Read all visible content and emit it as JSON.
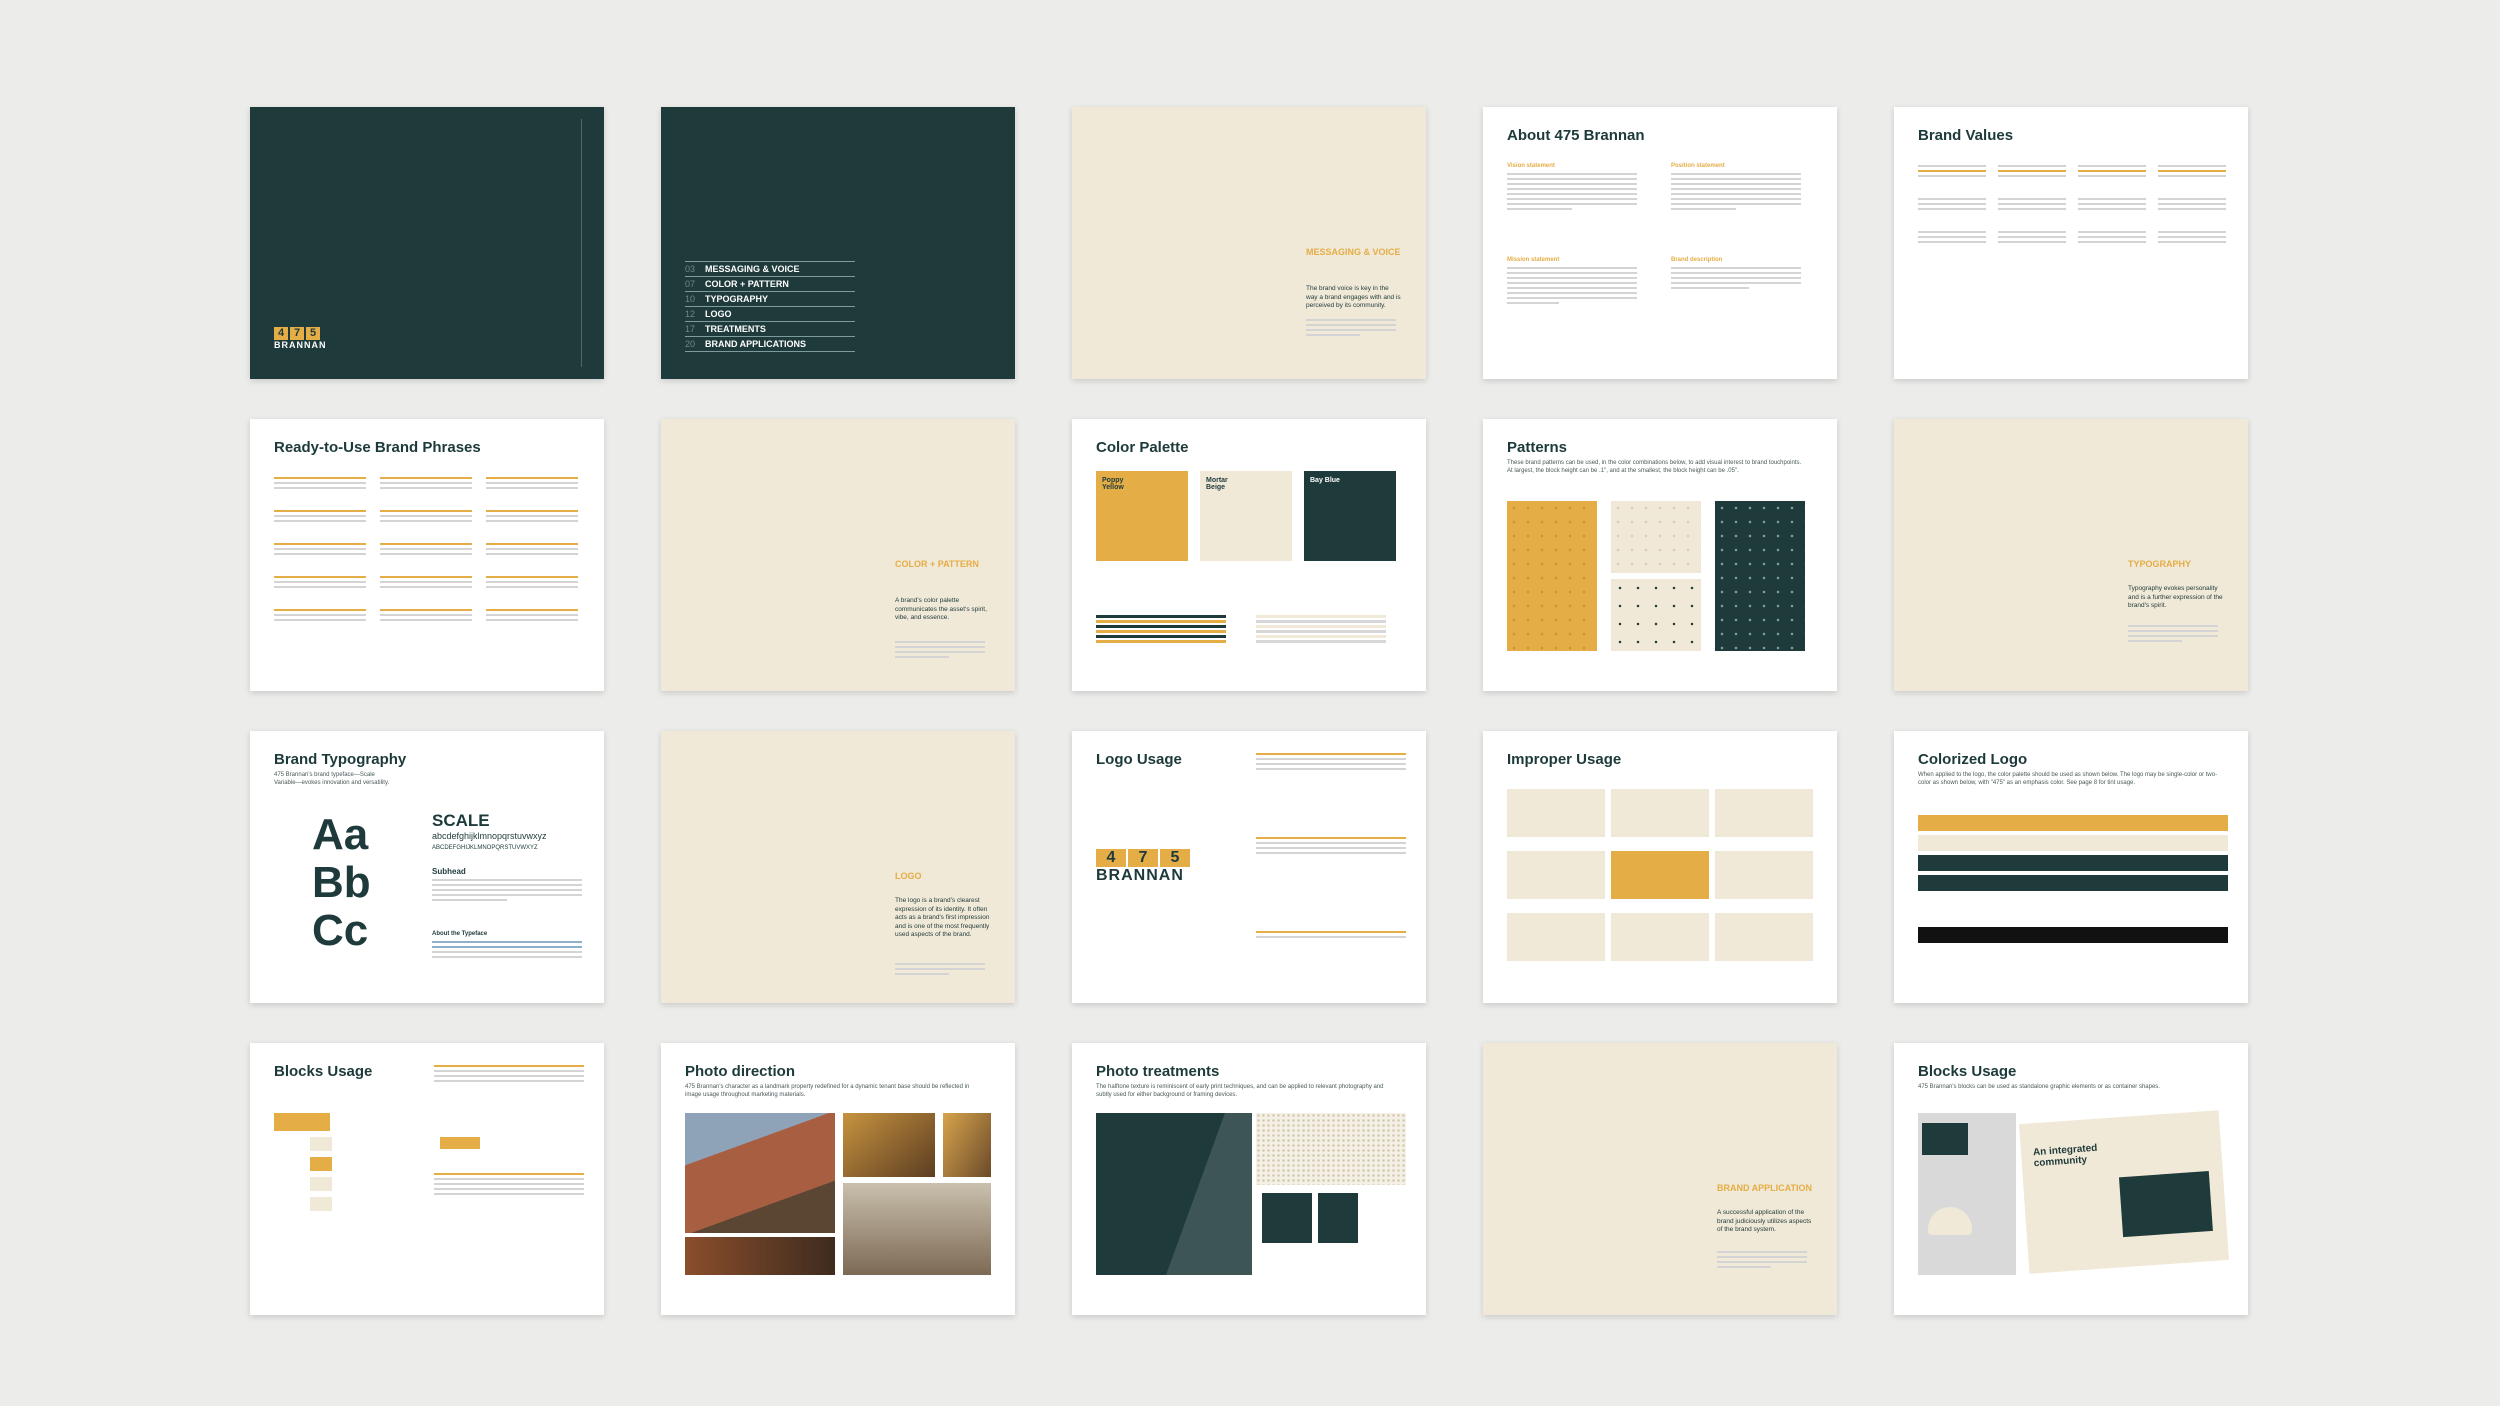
{
  "colors": {
    "teal": "#1f3a3b",
    "yellow": "#e4ad45",
    "beige": "#f1e9d7"
  },
  "logo": {
    "digits": [
      "4",
      "7",
      "5"
    ],
    "word": "BRANNAN"
  },
  "toc": [
    {
      "num": "03",
      "label": "MESSAGING & VOICE"
    },
    {
      "num": "07",
      "label": "COLOR + PATTERN"
    },
    {
      "num": "10",
      "label": "TYPOGRAPHY"
    },
    {
      "num": "12",
      "label": "LOGO"
    },
    {
      "num": "17",
      "label": "TREATMENTS"
    },
    {
      "num": "20",
      "label": "BRAND APPLICATIONS"
    }
  ],
  "pages": {
    "messaging": {
      "section": "MESSAGING & VOICE",
      "blurb": "The brand voice is key in the way a brand engages with and is perceived by its community."
    },
    "about": {
      "title": "About 475 Brannan",
      "vision": "Vision statement",
      "position": "Position statement",
      "mission": "Mission statement",
      "description": "Brand description"
    },
    "values": {
      "title": "Brand Values"
    },
    "phrases": {
      "title": "Ready-to-Use Brand Phrases"
    },
    "color_pattern": {
      "section": "COLOR + PATTERN",
      "blurb": "A brand's color palette communicates the asset's spirit, vibe, and essence."
    },
    "palette": {
      "title": "Color Palette",
      "swatches": [
        {
          "name": "Poppy Yellow"
        },
        {
          "name": "Mortar Beige"
        },
        {
          "name": "Bay Blue"
        }
      ]
    },
    "patterns": {
      "title": "Patterns",
      "sub": "These brand patterns can be used, in the color combinations below, to add visual interest to brand touchpoints. At largest, the block height can be .1\", and at the smallest, the block height can be .05\"."
    },
    "typography": {
      "section": "TYPOGRAPHY",
      "blurb": "Typography evokes personality and is a further expression of the brand's spirit."
    },
    "brand_type": {
      "title": "Brand Typography",
      "sub": "475 Brannan's brand typeface—Scale Variable—evokes innovation and versatility.",
      "specimen": [
        "Aa",
        "Bb",
        "Cc"
      ],
      "scale": "SCALE",
      "lower": "abcdefghijklmnopqrstuvwxyz",
      "upper": "ABCDEFGHIJKLMNOPQRSTUVWXYZ",
      "subhead": "Subhead",
      "about": "About the Typeface"
    },
    "logo_section": {
      "section": "LOGO",
      "blurb": "The logo is a brand's clearest expression of its identity. It often acts as a brand's first impression and is one of the most frequently used aspects of the brand."
    },
    "logo_usage": {
      "title": "Logo Usage"
    },
    "improper": {
      "title": "Improper Usage"
    },
    "colorized": {
      "title": "Colorized Logo",
      "sub": "When applied to the logo, the color palette should be used as shown below. The logo may be single-color or two-color as shown below, with \"475\" as an emphasis color. See page 8 for tint usage."
    },
    "blocks": {
      "title": "Blocks Usage"
    },
    "photo_dir": {
      "title": "Photo direction",
      "sub": "475 Brannan's character as a landmark property redefined for a dynamic tenant base should be reflected in image usage throughout marketing materials."
    },
    "photo_treat": {
      "title": "Photo treatments",
      "sub": "The halftone texture is reminiscent of early print techniques, and can be applied to relevant photography and subtly used for either background or framing devices."
    },
    "brand_app": {
      "section": "BRAND APPLICATION",
      "blurb": "A successful application of the brand judiciously utilizes aspects of the brand system."
    },
    "blocks2": {
      "title": "Blocks Usage",
      "sub": "475 Brannan's blocks can be used as standalone graphic elements or as container shapes.",
      "card": "An integrated community"
    }
  }
}
